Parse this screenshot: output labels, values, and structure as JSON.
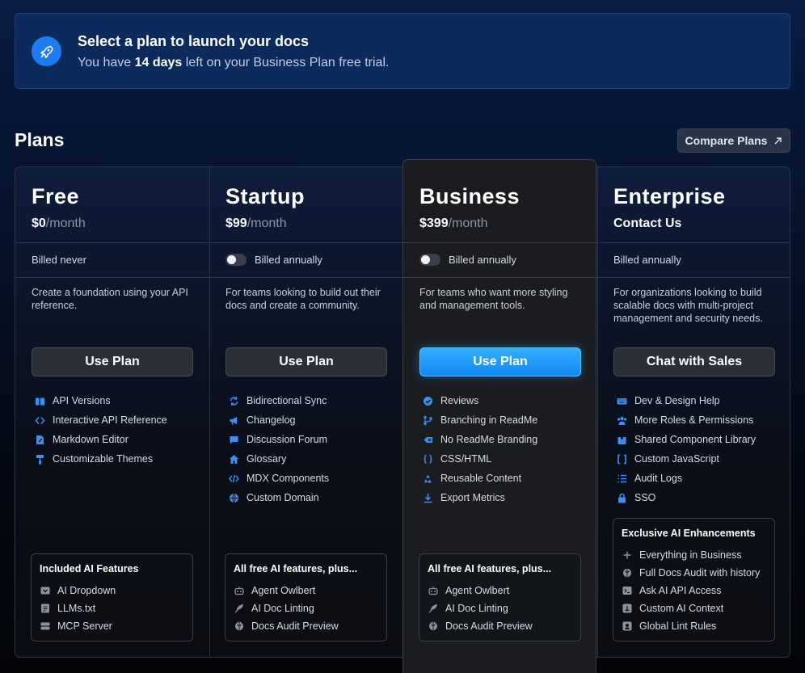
{
  "banner": {
    "title": "Select a plan to launch your docs",
    "sub_before": "You have ",
    "sub_bold": "14 days",
    "sub_after": " left on your Business Plan free trial."
  },
  "plans_heading": "Plans",
  "compare_label": "Compare Plans",
  "colors": {
    "accent": "#1d8ff5",
    "feature_icon": "#3a8ff0",
    "ai_icon": "#8d939e"
  },
  "plans": [
    {
      "name": "Free",
      "price": "$0",
      "unit": "/month",
      "billing": "Billed never",
      "toggle": false,
      "description": "Create a foundation using your API reference.",
      "button": "Use Plan",
      "features": [
        {
          "icon": "book-icon",
          "label": "API Versions"
        },
        {
          "icon": "code-brackets-icon",
          "label": "Interactive API Reference"
        },
        {
          "icon": "edit-document-icon",
          "label": "Markdown Editor"
        },
        {
          "icon": "paint-roller-icon",
          "label": "Customizable Themes"
        }
      ],
      "ai_title": "Included AI Features",
      "ai": [
        {
          "icon": "dropdown-icon",
          "label": "AI Dropdown"
        },
        {
          "icon": "text-file-icon",
          "label": "LLMs.txt"
        },
        {
          "icon": "server-icon",
          "label": "MCP Server"
        }
      ]
    },
    {
      "name": "Startup",
      "price": "$99",
      "unit": "/month",
      "billing": "Billed annually",
      "toggle": true,
      "description": "For teams looking to build out their docs and create a community.",
      "button": "Use Plan",
      "features": [
        {
          "icon": "sync-icon",
          "label": "Bidirectional Sync"
        },
        {
          "icon": "megaphone-icon",
          "label": "Changelog"
        },
        {
          "icon": "chat-bubble-icon",
          "label": "Discussion Forum"
        },
        {
          "icon": "home-icon",
          "label": "Glossary"
        },
        {
          "icon": "code-icon",
          "label": "MDX Components"
        },
        {
          "icon": "globe-icon",
          "label": "Custom Domain"
        }
      ],
      "ai_title": "All free AI features, plus...",
      "ai": [
        {
          "icon": "robot-icon",
          "label": "Agent Owlbert"
        },
        {
          "icon": "feather-icon",
          "label": "AI Doc Linting"
        },
        {
          "icon": "brain-icon",
          "label": "Docs Audit Preview"
        }
      ]
    },
    {
      "name": "Business",
      "price": "$399",
      "unit": "/month",
      "billing": "Billed annually",
      "toggle": true,
      "description": "For teams who want more styling and management tools.",
      "button": "Use Plan",
      "features": [
        {
          "icon": "check-badge-icon",
          "label": "Reviews"
        },
        {
          "icon": "branch-icon",
          "label": "Branching in ReadMe"
        },
        {
          "icon": "eraser-icon",
          "label": "No ReadMe Branding"
        },
        {
          "icon": "braces-icon",
          "label": "CSS/HTML"
        },
        {
          "icon": "recycle-icon",
          "label": "Reusable Content"
        },
        {
          "icon": "download-icon",
          "label": "Export Metrics"
        }
      ],
      "ai_title": "All free AI features, plus...",
      "ai": [
        {
          "icon": "robot-icon",
          "label": "Agent Owlbert"
        },
        {
          "icon": "feather-icon",
          "label": "AI Doc Linting"
        },
        {
          "icon": "brain-icon",
          "label": "Docs Audit Preview"
        }
      ]
    },
    {
      "name": "Enterprise",
      "price": "Contact Us",
      "unit": "",
      "billing": "Billed annually",
      "toggle": false,
      "description": "For organizations looking to build scalable docs with multi-project management and security needs.",
      "button": "Chat with Sales",
      "features": [
        {
          "icon": "keyboard-icon",
          "label": "Dev & Design Help"
        },
        {
          "icon": "people-icon",
          "label": "More Roles & Permissions"
        },
        {
          "icon": "package-icon",
          "label": "Shared Component Library"
        },
        {
          "icon": "bracket-icon",
          "label": "Custom JavaScript"
        },
        {
          "icon": "list-icon",
          "label": "Audit Logs"
        },
        {
          "icon": "lock-icon",
          "label": "SSO"
        }
      ],
      "ai_title": "Exclusive AI Enhancements",
      "ai": [
        {
          "icon": "plus-icon",
          "label": "Everything in Business"
        },
        {
          "icon": "brain-icon",
          "label": "Full Docs Audit with history"
        },
        {
          "icon": "terminal-icon",
          "label": "Ask AI API Access"
        },
        {
          "icon": "context-icon",
          "label": "Custom AI Context"
        },
        {
          "icon": "rules-icon",
          "label": "Global Lint Rules"
        }
      ]
    }
  ]
}
